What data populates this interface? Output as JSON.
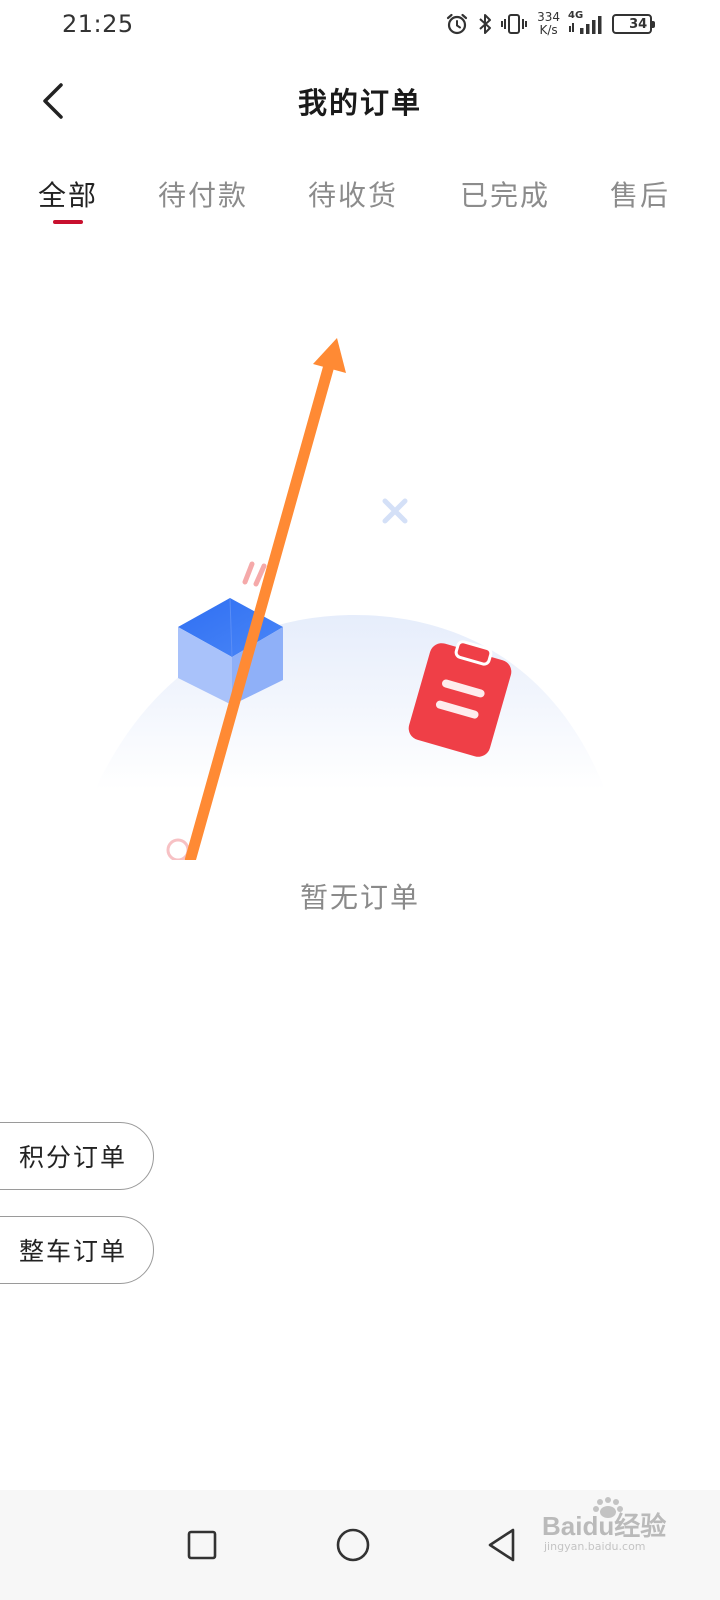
{
  "status_bar": {
    "time": "21:25",
    "net_speed_value": "334",
    "net_speed_unit": "K/s",
    "network_type": "4G",
    "battery_level": "34",
    "icons": [
      "alarm-icon",
      "bluetooth-icon",
      "vibrate-icon",
      "signal-icon",
      "battery-icon"
    ]
  },
  "header": {
    "title": "我的订单",
    "back_icon": "chevron-left-icon"
  },
  "tabs": [
    {
      "label": "全部",
      "active": true
    },
    {
      "label": "待付款",
      "active": false
    },
    {
      "label": "待收货",
      "active": false
    },
    {
      "label": "已完成",
      "active": false
    },
    {
      "label": "售后",
      "active": false
    }
  ],
  "empty_state": {
    "text": "暂无订单",
    "icons": [
      "box-icon",
      "clipboard-icon",
      "x-decoration-icon",
      "circle-decoration-icon"
    ]
  },
  "side_buttons": {
    "points_orders": "积分订单",
    "vehicle_orders": "整车订单"
  },
  "annotation": {
    "arrow_color": "#ff8a34"
  },
  "nav_bar": {
    "icons": [
      "recent-apps-icon",
      "home-icon",
      "back-icon"
    ]
  },
  "watermark": {
    "text": "Baidu经验",
    "subtext": "jingyan.baidu.com"
  },
  "colors": {
    "accent": "#c8102e",
    "box_blue": "#3d7af5",
    "clipboard_red": "#ef3f47"
  }
}
